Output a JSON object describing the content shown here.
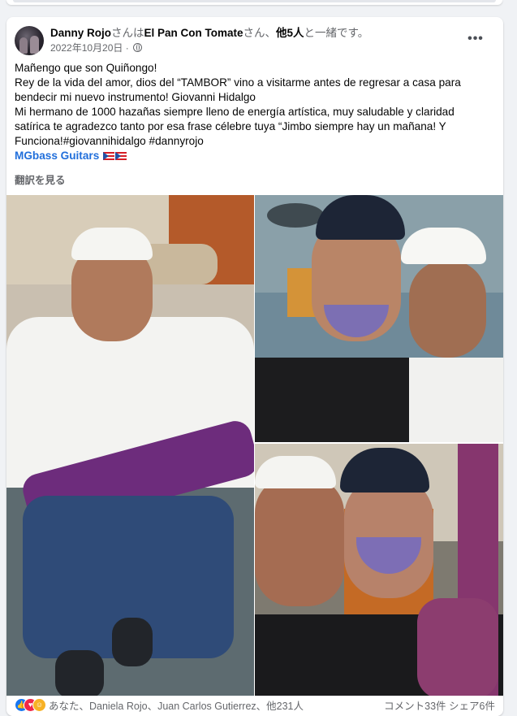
{
  "post": {
    "author": "Danny Rojo",
    "with_text_1": "さんは",
    "tagged_page": "El Pan Con Tomate",
    "with_text_2": "さん、",
    "others": "他5人",
    "with_text_3": "と一緒です。",
    "date": "2022年10月20日",
    "date_sep": "·",
    "privacy_icon": "globe-icon",
    "more_icon": "more-dots-icon",
    "more_label": "•••",
    "lines": [
      "Mañengo que son Quiñongo!",
      "Rey de la vida del amor, dios del “TAMBOR” vino a visitarme antes de regresar a casa para",
      "bendecir mi nuevo instrumento! Giovanni Hidalgo",
      "Mi hermano de 1000 hazañas siempre lleno de energía artística, muy saludable y claridad",
      "satírica te agradezco tanto por esa frase célebre tuya “Jimbo siempre hay un mañana! Y",
      "Funciona!#giovannihidalgo #dannyrojo"
    ],
    "link_text": "MGbass Guitars",
    "flag_icons": [
      "cuba-flag-icon",
      "puerto-rico-flag-icon"
    ],
    "translate_label": "翻訳を見る"
  },
  "reactions": {
    "icons": [
      "like-icon",
      "love-icon",
      "care-icon"
    ],
    "like_glyph": "👍",
    "love_glyph": "♥",
    "care_glyph": "☺",
    "names_text": "あなた、Daniela Rojo、Juan Carlos Gutierrez、他231人",
    "comments": "コメント33件",
    "shares": "シェア6件"
  },
  "colors": {
    "link": "#216fdb",
    "secondary_text": "#65676b",
    "background": "#f0f2f5"
  }
}
